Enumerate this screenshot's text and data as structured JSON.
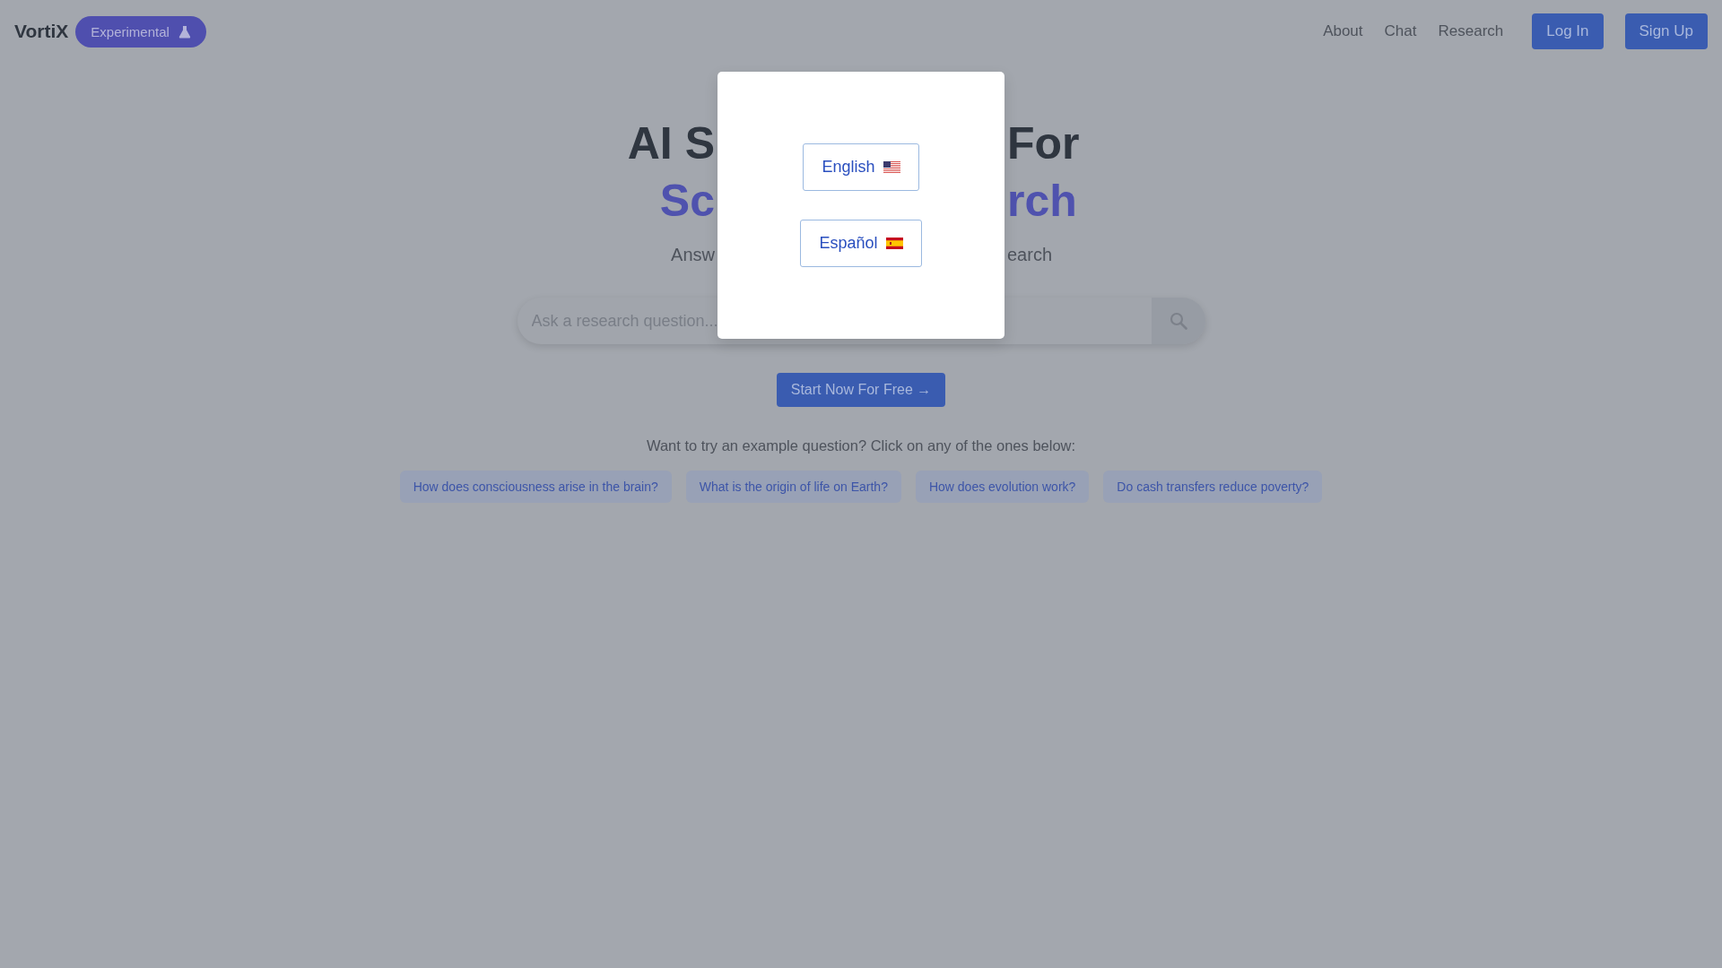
{
  "header": {
    "logo": "VortiX",
    "badge": "Experimental",
    "nav": [
      "About",
      "Chat",
      "Research"
    ],
    "buttons": [
      "Log In",
      "Sign Up"
    ]
  },
  "hero": {
    "title_lines": [
      {
        "left": "AI S",
        "right": "For"
      },
      {
        "left": "Sc",
        "right": "rch"
      }
    ],
    "subtitle": {
      "left": "Answ",
      "right": "earch"
    }
  },
  "search": {
    "placeholder": "Ask a research question..."
  },
  "cta": "Start Now For Free →",
  "examples": {
    "prompt": "Want to try an example question? Click on any of the ones below:",
    "questions": [
      "How does consciousness arise in the brain?",
      "What is the origin of life on Earth?",
      "How does evolution work?",
      "Do cash transfers reduce poverty?"
    ]
  },
  "language_dialog": {
    "options": [
      {
        "label": "English",
        "kind": "us"
      },
      {
        "label": "Español",
        "kind": "es"
      }
    ]
  }
}
